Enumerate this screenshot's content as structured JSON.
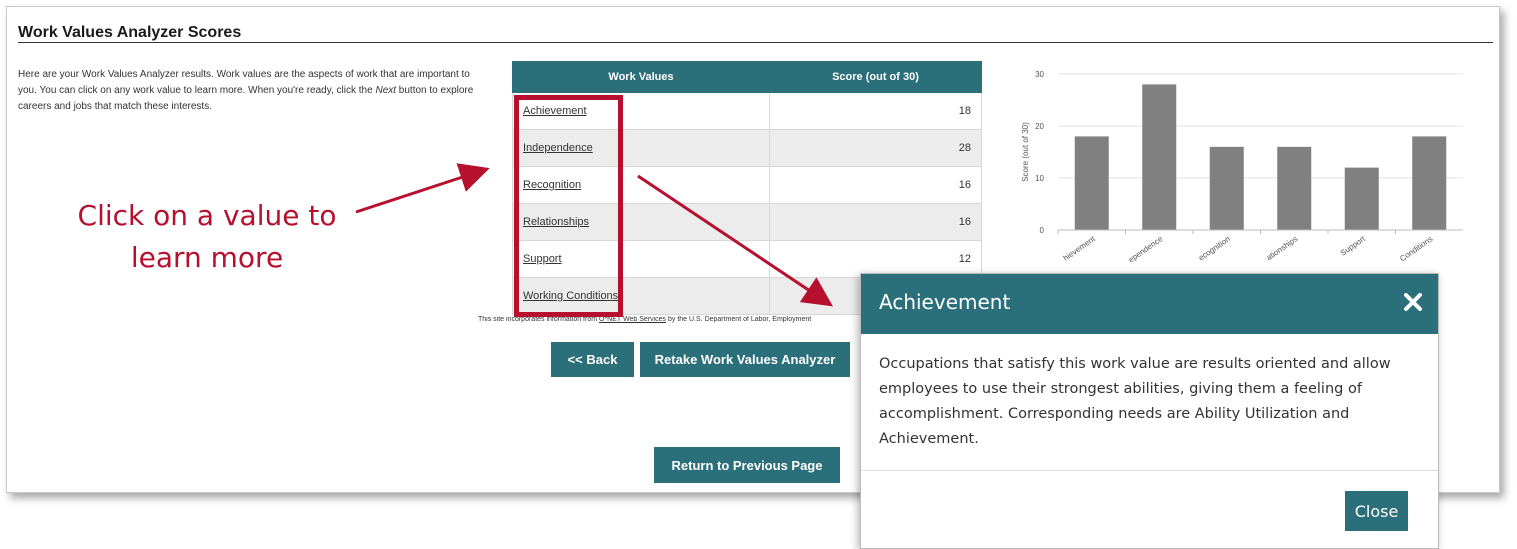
{
  "page": {
    "title": "Work Values Analyzer Scores",
    "intro_part1": "Here are your Work Values Analyzer results. Work values are the aspects of work that are important to you. You can click on any work value to learn more. When you're ready, click the ",
    "intro_next": "Next",
    "intro_part2": " button to explore careers and jobs that match these interests."
  },
  "table": {
    "headers": [
      "Work Values",
      "Score (out of 30)"
    ],
    "rows": [
      {
        "value": "Achievement",
        "score": "18"
      },
      {
        "value": "Independence",
        "score": "28"
      },
      {
        "value": "Recognition",
        "score": "16"
      },
      {
        "value": "Relationships",
        "score": "16"
      },
      {
        "value": "Support",
        "score": "12"
      },
      {
        "value": "Working Conditions",
        "score": ""
      }
    ]
  },
  "credit": {
    "prefix": "This site incorporates information from ",
    "link": "O*NET Web Services",
    "suffix": " by the U.S. Department of Labor, Employment"
  },
  "buttons": {
    "back": "<< Back",
    "retake": "Retake Work Values Analyzer",
    "return": "Return to Previous Page"
  },
  "annotation": {
    "line1": "Click on a value to",
    "line2": "learn more"
  },
  "modal": {
    "title": "Achievement",
    "body": "Occupations that satisfy this work value are results oriented and allow employees to use their strongest abilities, giving them a feeling of accomplishment. Corresponding needs are Ability Utilization and Achievement.",
    "close_label": "Close"
  },
  "colors": {
    "teal": "#2b6f7b",
    "annotation_red": "#b7102e",
    "bar_gray": "#808080"
  },
  "chart_data": {
    "type": "bar",
    "categories": [
      "Achievement",
      "Independence",
      "Recognition",
      "Relationships",
      "Support",
      "Working Conditions"
    ],
    "tick_labels": [
      "hievement",
      "ependence",
      "ecognition",
      "ationships",
      "Support",
      "Conditions"
    ],
    "values": [
      18,
      28,
      16,
      16,
      12,
      18
    ],
    "ylabel": "Score (out of 30)",
    "ylim": [
      0,
      30
    ],
    "yticks": [
      "0",
      "10",
      "20",
      "30"
    ],
    "grid": true
  }
}
